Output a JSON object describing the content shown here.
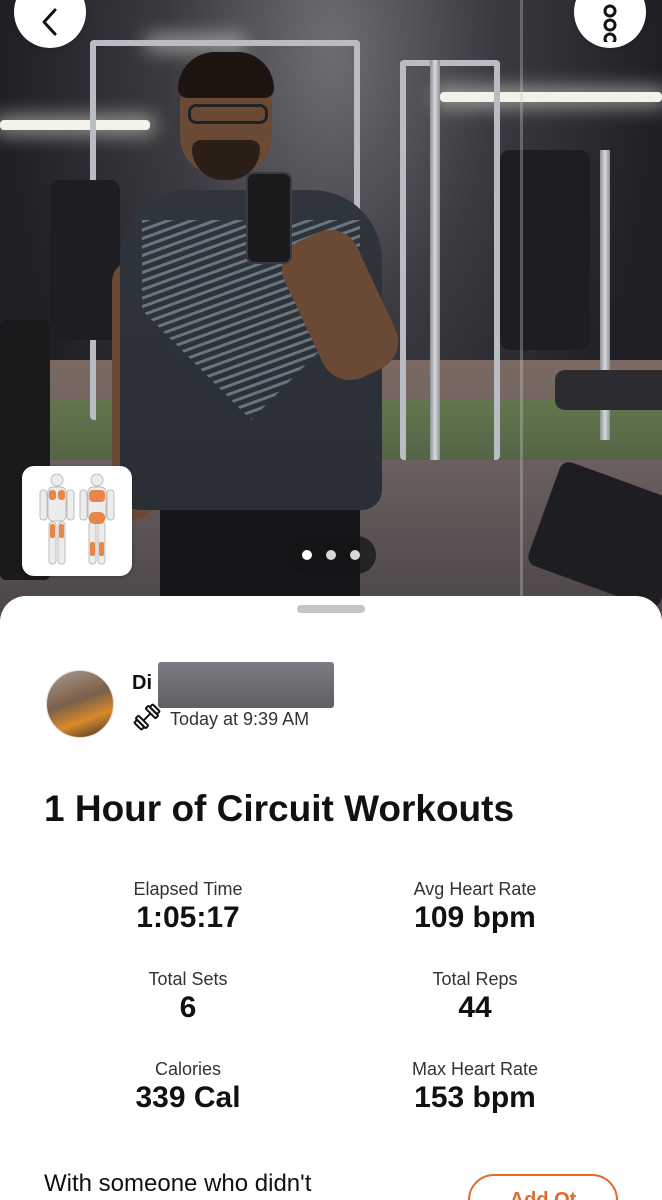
{
  "hero": {
    "page_indicator": {
      "count": 3,
      "active_index": 0
    }
  },
  "post": {
    "author_name_visible": "Di",
    "time": "Today at 9:39 AM",
    "activity_icon": "dumbbell-icon"
  },
  "workout": {
    "title": "1 Hour of Circuit Workouts",
    "stats": [
      {
        "label": "Elapsed Time",
        "value": "1:05:17"
      },
      {
        "label": "Avg Heart Rate",
        "value": "109 bpm"
      },
      {
        "label": "Total Sets",
        "value": "6"
      },
      {
        "label": "Total Reps",
        "value": "44"
      },
      {
        "label": "Calories",
        "value": "339 Cal"
      },
      {
        "label": "Max Heart Rate",
        "value": "153 bpm"
      }
    ]
  },
  "footer": {
    "prompt": "With someone who didn't",
    "add_button_label": "Add Ot"
  },
  "colors": {
    "accent": "#e46a2e",
    "muscle_highlight": "#e8864a"
  }
}
